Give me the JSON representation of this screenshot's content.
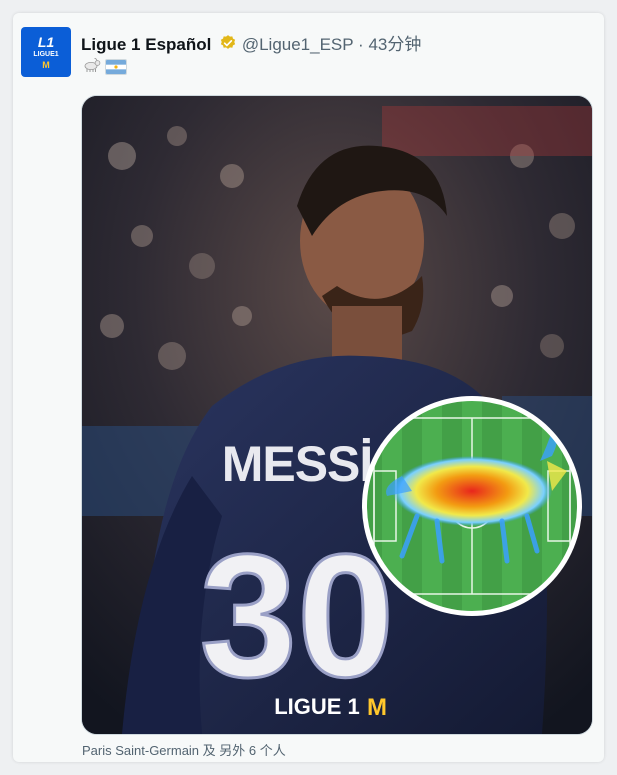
{
  "tweet": {
    "author_name": "Ligue 1 Español",
    "handle": "@Ligue1_ESP",
    "separator": "·",
    "time": "43分钟",
    "emojis": [
      "goat-emoji",
      "argentina-flag-emoji"
    ]
  },
  "avatar": {
    "logo_text": "L1",
    "logo_sub": "LIGUE1",
    "logo_mark": "M"
  },
  "media": {
    "jersey_name": "MESSİ",
    "jersey_number": "30",
    "sponsor_text": "LIGUE 1",
    "sponsor_mark": "M",
    "inset_description_icon": "goat-heatmap-icon"
  },
  "footer": {
    "tagged": "Paris Saint-Germain 及 另外 6 个人"
  },
  "colors": {
    "accent_blue": "#1d9bf0",
    "verified_gold": "#e2b719",
    "jersey_navy": "#1c2444",
    "pitch_green": "#4caf50"
  }
}
